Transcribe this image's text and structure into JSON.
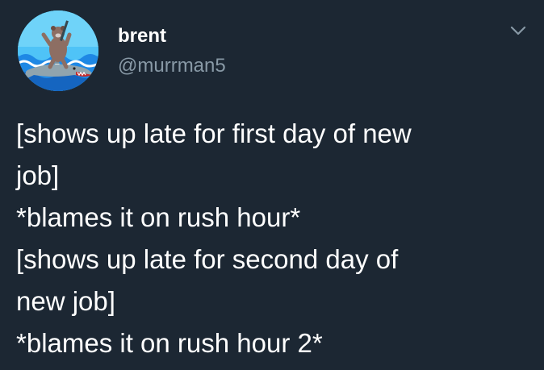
{
  "user": {
    "display_name": "brent",
    "handle": "@murrman5",
    "avatar_icon": "bear-riding-shark-avatar"
  },
  "menu": {
    "icon": "chevron-down-icon"
  },
  "tweet": {
    "lines": [
      "[shows up late for first day of new",
      "job]",
      "*blames it on rush hour*",
      "[shows up late for second day of",
      "new job]",
      "*blames it on rush hour 2*"
    ]
  },
  "colors": {
    "background": "#1c2733",
    "text_primary": "#ffffff",
    "text_secondary": "#8899a6"
  }
}
